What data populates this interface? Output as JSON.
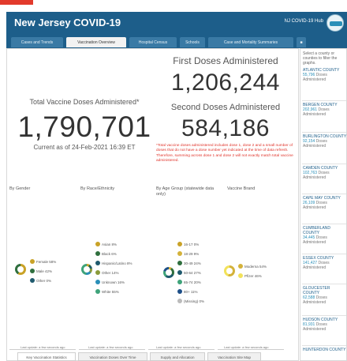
{
  "header": {
    "title": "New Jersey COVID-19",
    "hub_label": "NJ COVID-19 Hub"
  },
  "tabs": [
    {
      "label": "Cases and Trends"
    },
    {
      "label": "Vaccination Overview"
    },
    {
      "label": "Hospital Census"
    },
    {
      "label": "Schools"
    },
    {
      "label": "Case and Mortality Summaries"
    },
    {
      "label": "■"
    }
  ],
  "kpi": {
    "total_label": "Total Vaccine Doses Administered*",
    "total_value": "1,790,701",
    "as_of": "Current as of 24-Feb-2021 16:39 ET",
    "first_label": "First Doses Administered",
    "first_value": "1,206,244",
    "second_label": "Second Doses Administered",
    "second_value": "584,186",
    "note": "*Total vaccine doses administered includes dose 1, dose 2 and a small number of doses that do not have a dose number yet indicated at the time of data refresh. Therefore, summing across dose 1 and dose 2 will not exactly match total vaccine administered."
  },
  "sections": {
    "gender": {
      "title": "By Gender",
      "items": [
        {
          "label": "Female 58%",
          "color": "#c9a227"
        },
        {
          "label": "Male 42%",
          "color": "#2f6f3e"
        },
        {
          "label": "Other 0%",
          "color": "#1f5a6e"
        }
      ]
    },
    "race": {
      "title": "By Race/Ethnicity",
      "items": [
        {
          "label": "Asian 8%",
          "color": "#c9a227"
        },
        {
          "label": "Black 6%",
          "color": "#2f6f3e"
        },
        {
          "label": "Hispanic/Latino 8%",
          "color": "#1f5a6e"
        },
        {
          "label": "Other 14%",
          "color": "#8a9a3a"
        },
        {
          "label": "Unknown 16%",
          "color": "#2a8fb8"
        },
        {
          "label": "White 55%",
          "color": "#3fa37a"
        }
      ]
    },
    "age": {
      "title": "By Age Group (statewide data only)",
      "items": [
        {
          "label": "16-17 0%",
          "color": "#c9a227"
        },
        {
          "label": "18-29 9%",
          "color": "#d4b23a"
        },
        {
          "label": "30-49 24%",
          "color": "#2f6f3e"
        },
        {
          "label": "50-64 27%",
          "color": "#1f5a6e"
        },
        {
          "label": "65-74 20%",
          "color": "#3fa37a"
        },
        {
          "label": "80+ 11%",
          "color": "#1d4f88"
        },
        {
          "label": "(Missing) 0%",
          "color": "#bbbbbb"
        }
      ]
    },
    "brand": {
      "title": "Vaccine Brand",
      "items": [
        {
          "label": "Moderna 54%",
          "color": "#d4b23a"
        },
        {
          "label": "Pfizer 46%",
          "color": "#f2e25a"
        }
      ]
    },
    "last_update": "Last update: a few seconds ago"
  },
  "bottom_tabs": [
    {
      "label": "Key Vaccination Statistics"
    },
    {
      "label": "Vaccination Doses Over Time"
    },
    {
      "label": "Supply and Allocation"
    },
    {
      "label": "Vaccination Site Map"
    }
  ],
  "sidebar": {
    "intro": "Select a county or counties to filter the graphs.",
    "dose_label": "Doses Administered",
    "counties": [
      {
        "name": "ATLANTIC COUNTY",
        "value": "55,796"
      },
      {
        "name": "BERGEN COUNTY",
        "value": "202,961"
      },
      {
        "name": "BURLINGTON COUNTY",
        "value": "92,154"
      },
      {
        "name": "CAMDEN COUNTY",
        "value": "102,763"
      },
      {
        "name": "CAPE MAY COUNTY",
        "value": "26,109"
      },
      {
        "name": "CUMBERLAND COUNTY",
        "value": "34,445"
      },
      {
        "name": "ESSEX COUNTY",
        "value": "141,427"
      },
      {
        "name": "GLOUCESTER COUNTY",
        "value": "62,588"
      },
      {
        "name": "HUDSON COUNTY",
        "value": "81,931"
      },
      {
        "name": "HUNTERDON COUNTY",
        "value": ""
      }
    ]
  }
}
